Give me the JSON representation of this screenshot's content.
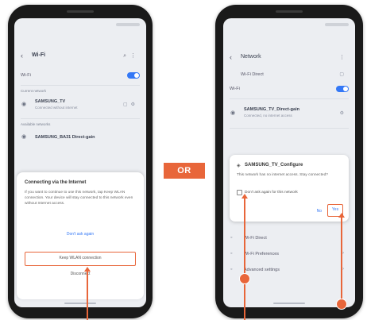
{
  "separator": {
    "label": "OR"
  },
  "left_phone": {
    "header": {
      "title": "Wi-Fi"
    },
    "wifi_toggle": {
      "label": "Wi-Fi",
      "on": true
    },
    "current_section": "Current network",
    "current_network": {
      "name": "SAMSUNG_TV",
      "status": "Connected without internet"
    },
    "available_section": "Available networks",
    "available_network": {
      "name": "SAMSUNG_BA31 Direct-gain"
    },
    "dialog": {
      "title": "Connecting via the Internet",
      "body": "If you want to continue to use this network, tap Keep WLAN connection. Your device will stay connected to this network even without Internet access.",
      "link": "Don't ask again",
      "primary_button": "Keep WLAN connection",
      "secondary_button": "Disconnect"
    }
  },
  "right_phone": {
    "header": {
      "title": "Network"
    },
    "top_row": {
      "label": "Wi-Fi Direct"
    },
    "wifi_toggle": {
      "label": "Wi-Fi",
      "on": true
    },
    "network": {
      "name": "SAMSUNG_TV_Direct-gain",
      "status": "Connected, no internet access"
    },
    "dialog": {
      "title": "SAMSUNG_TV_Configure",
      "body": "This network has no internet access. Stay connected?",
      "checkbox_label": "Don't ask again for this network",
      "no_button": "No",
      "yes_button": "Yes"
    },
    "menu_items": [
      "Wi-Fi Direct",
      "Wi-Fi Preferences",
      "Advanced settings"
    ]
  },
  "colors": {
    "accent": "#e8663a",
    "link": "#3478f6"
  }
}
